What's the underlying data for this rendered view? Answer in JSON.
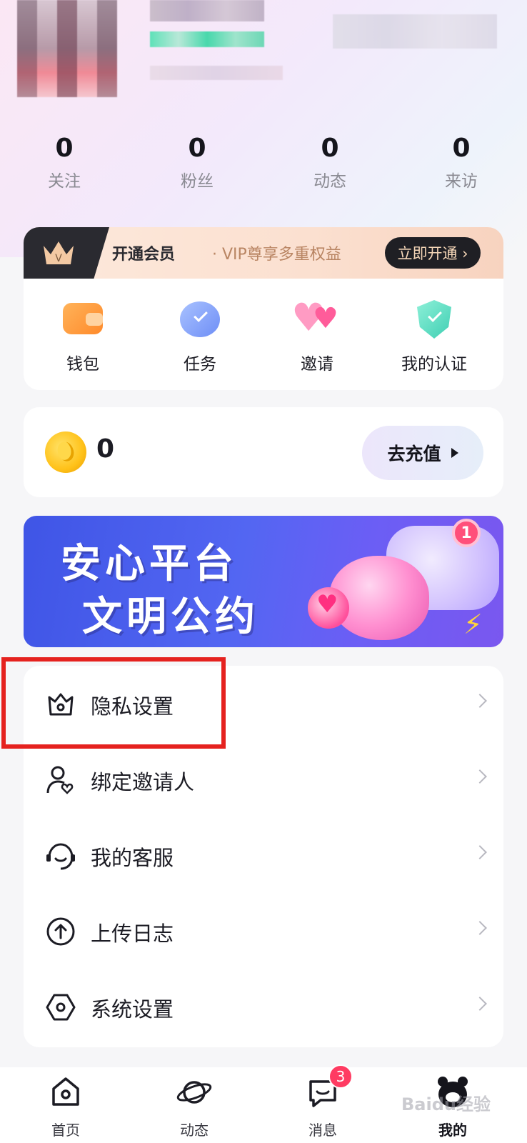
{
  "profile": {
    "stats": [
      {
        "value": "0",
        "label": "关注"
      },
      {
        "value": "0",
        "label": "粉丝"
      },
      {
        "value": "0",
        "label": "动态"
      },
      {
        "value": "0",
        "label": "来访"
      }
    ]
  },
  "vip": {
    "title": "开通会员",
    "subtitle": "· VIP尊享多重权益",
    "button": "立即开通 ›",
    "crown_letter": "V"
  },
  "quick_actions": [
    {
      "label": "钱包",
      "icon": "wallet-icon"
    },
    {
      "label": "任务",
      "icon": "task-icon"
    },
    {
      "label": "邀请",
      "icon": "invite-hearts-icon"
    },
    {
      "label": "我的认证",
      "icon": "verify-shield-icon"
    }
  ],
  "coins": {
    "balance": "0",
    "recharge_label": "去充值"
  },
  "banner": {
    "line1": "安心平台",
    "line2": "文明公约",
    "notification_count": "1"
  },
  "menu": [
    {
      "label": "隐私设置",
      "icon": "privacy-crown-icon"
    },
    {
      "label": "绑定邀请人",
      "icon": "bind-inviter-icon"
    },
    {
      "label": "我的客服",
      "icon": "customer-service-icon"
    },
    {
      "label": "上传日志",
      "icon": "upload-log-icon"
    },
    {
      "label": "系统设置",
      "icon": "settings-hex-icon"
    }
  ],
  "tabbar": [
    {
      "label": "首页",
      "icon": "home-icon"
    },
    {
      "label": "动态",
      "icon": "planet-icon"
    },
    {
      "label": "消息",
      "icon": "message-icon",
      "badge": "3"
    },
    {
      "label": "我的",
      "icon": "profile-avatar-icon",
      "active": true
    }
  ],
  "watermark": "Baidu经验",
  "colors": {
    "highlight": "#e5221f",
    "badge": "#ff3b62",
    "vip_button_bg": "#1f1f24",
    "banner_blue": "#4a5cee"
  }
}
